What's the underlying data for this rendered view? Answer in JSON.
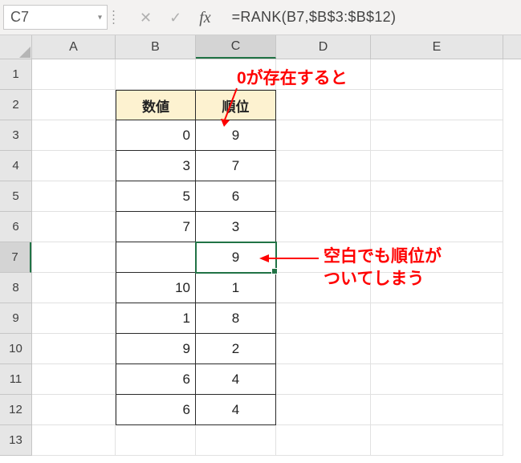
{
  "formula_bar": {
    "name_box": "C7",
    "cancel": "✕",
    "enter": "✓",
    "fx": "fx",
    "formula": "=RANK(B7,$B$3:$B$12)"
  },
  "columns": [
    "A",
    "B",
    "C",
    "D",
    "E"
  ],
  "active_col_index": 2,
  "rows": [
    "1",
    "2",
    "3",
    "4",
    "5",
    "6",
    "7",
    "8",
    "9",
    "10",
    "11",
    "12",
    "13"
  ],
  "active_row_index": 6,
  "table": {
    "header": {
      "b": "数値",
      "c": "順位"
    },
    "data": [
      {
        "b": "0",
        "c": "9"
      },
      {
        "b": "3",
        "c": "7"
      },
      {
        "b": "5",
        "c": "6"
      },
      {
        "b": "7",
        "c": "3"
      },
      {
        "b": "",
        "c": "9"
      },
      {
        "b": "10",
        "c": "1"
      },
      {
        "b": "1",
        "c": "8"
      },
      {
        "b": "9",
        "c": "2"
      },
      {
        "b": "6",
        "c": "4"
      },
      {
        "b": "6",
        "c": "4"
      }
    ]
  },
  "annotations": {
    "top": "0が存在すると",
    "side_line1": "空白でも順位が",
    "side_line2": "ついてしまう"
  },
  "chart_data": {
    "type": "table",
    "title": "RANK function with zero and blank",
    "columns": [
      "数値",
      "順位"
    ],
    "rows": [
      [
        0,
        9
      ],
      [
        3,
        7
      ],
      [
        5,
        6
      ],
      [
        7,
        3
      ],
      [
        null,
        9
      ],
      [
        10,
        1
      ],
      [
        1,
        8
      ],
      [
        9,
        2
      ],
      [
        6,
        4
      ],
      [
        6,
        4
      ]
    ],
    "formula": "=RANK(B7,$B$3:$B$12)",
    "active_cell": "C7"
  }
}
